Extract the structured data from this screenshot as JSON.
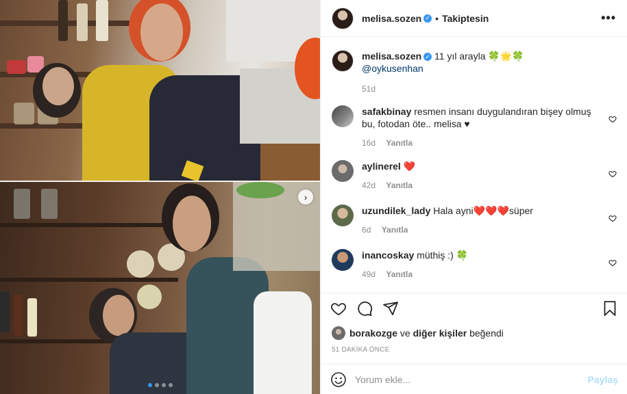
{
  "header": {
    "username": "melisa.sozen",
    "separator": "•",
    "follow_status": "Takiptesin",
    "more_label": "•••"
  },
  "caption": {
    "username": "melisa.sozen",
    "text": "11 yıl arayla 🍀🌟🍀",
    "mention": "@oykusenhan",
    "time": "51d"
  },
  "comments": [
    {
      "username": "safakbinay",
      "text": "resmen insanı duygulandıran bişey olmuş bu, fotodan öte.. melisa ♥",
      "time": "16d",
      "reply": "Yanıtla"
    },
    {
      "username": "aylinerel",
      "text": "❤️",
      "time": "42d",
      "reply": "Yanıtla"
    },
    {
      "username": "uzundilek_lady",
      "text": "Hala ayni❤️❤️❤️süper",
      "time": "6d",
      "reply": "Yanıtla"
    },
    {
      "username": "inancoskay",
      "text": "müthiş :) 🍀",
      "time": "49d",
      "reply": "Yanıtla"
    }
  ],
  "likes": {
    "user": "borakozge",
    "connector": "ve",
    "others": "diğer kişiler",
    "suffix": "beğendi"
  },
  "timestamp": "51 DAKİKA ÖNCE",
  "add_comment": {
    "placeholder": "Yorum ekle...",
    "post_label": "Paylaş"
  },
  "carousel": {
    "next_label": "›",
    "total_slides": 4,
    "active_slide": 1
  },
  "colors": {
    "verified_blue": "#3897f0",
    "active_dot": "#3897f0",
    "post_button_disabled": "#b2dffc",
    "meta_gray": "#8e8e8e"
  }
}
